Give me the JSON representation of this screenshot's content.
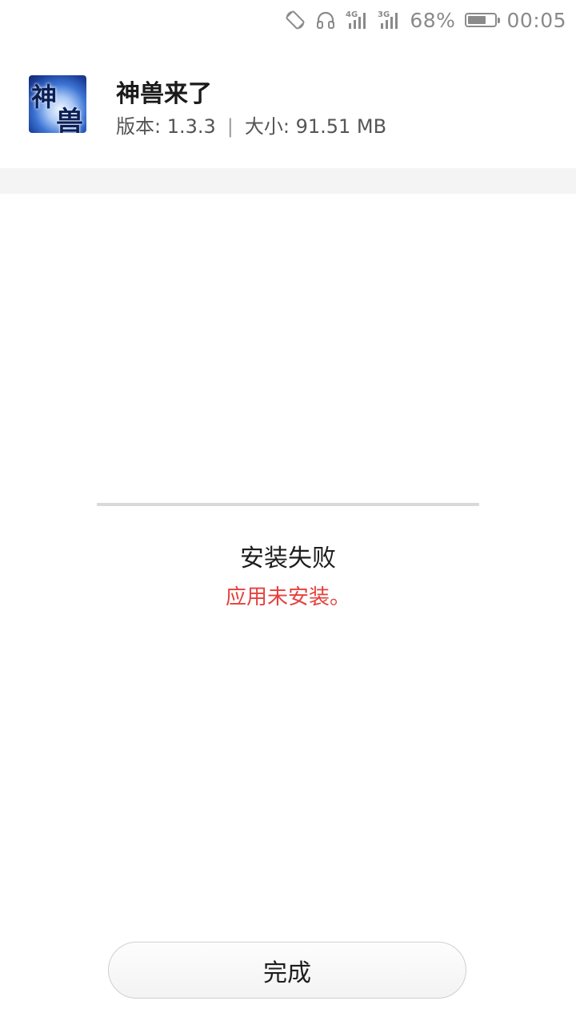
{
  "status_bar": {
    "icons": [
      "screen-rotation-icon",
      "headphones-icon",
      "signal-4g-icon",
      "signal-3g-icon"
    ],
    "signal_4g_label": "4G",
    "signal_3g_label": "3G",
    "battery_text": "68%",
    "battery_level": 0.68,
    "time": "00:05"
  },
  "app": {
    "icon_chars": [
      "神",
      "兽"
    ],
    "name": "神兽来了",
    "version_label": "版本: 1.3.3",
    "separator": "|",
    "size_label": "大小: 91.51 MB"
  },
  "result": {
    "title": "安装失败",
    "detail": "应用未安装。",
    "detail_color": "#e5413e"
  },
  "actions": {
    "done_label": "完成"
  }
}
